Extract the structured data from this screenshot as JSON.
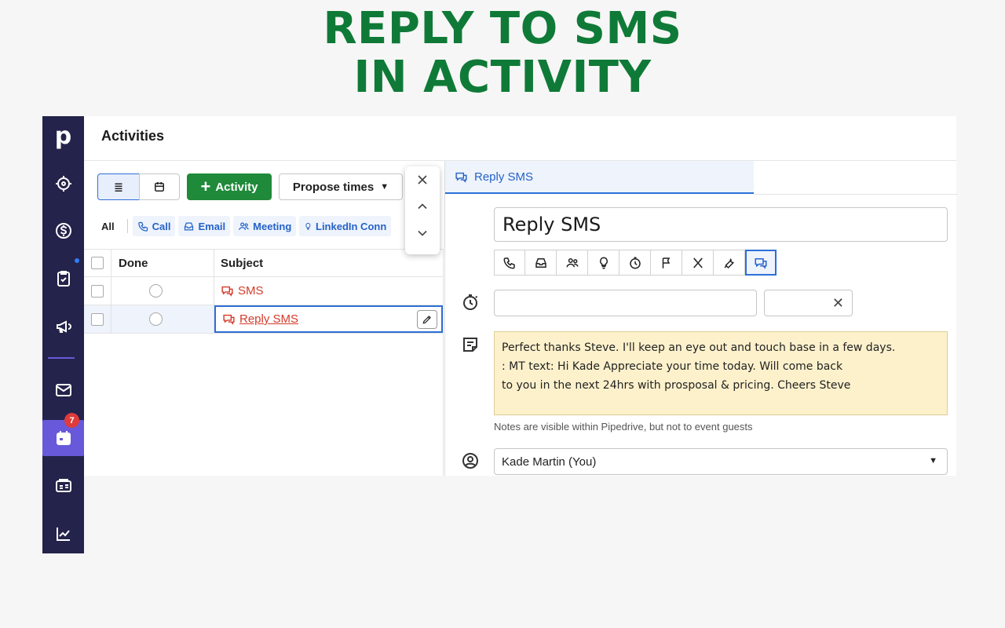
{
  "headline": {
    "line1": "REPLY TO SMS",
    "line2": "IN ACTIVITY"
  },
  "sidebar": {
    "logo": "p",
    "badge_count": "7",
    "items": [
      "target-icon",
      "dollar-icon",
      "checklist-icon",
      "megaphone-icon",
      "mail-icon",
      "calendar-icon",
      "contacts-icon",
      "chart-icon"
    ]
  },
  "main": {
    "title": "Activities",
    "toolbar": {
      "activity_label": "Activity",
      "propose_label": "Propose times"
    },
    "filters": {
      "all": "All",
      "call": "Call",
      "email": "Email",
      "meeting": "Meeting",
      "linkedin": "LinkedIn Conn"
    },
    "table": {
      "headers": {
        "done": "Done",
        "subject": "Subject"
      },
      "rows": [
        {
          "subject": "SMS"
        },
        {
          "subject": "Reply SMS"
        }
      ]
    }
  },
  "pane": {
    "tab_label": "Reply SMS",
    "subject_value": "Reply SMS",
    "note_lines": [
      "Perfect thanks Steve. I'll keep an eye out and touch base in a few days.",
      ": MT text: Hi Kade Appreciate your time today. Will come back",
      " to you in the next 24hrs with prosposal & pricing. Cheers Steve"
    ],
    "note_hint": "Notes are visible within Pipedrive, but not to event guests",
    "owner": "Kade Martin (You)"
  },
  "colors": {
    "accent_green": "#0f7a37",
    "sidebar": "#24234b",
    "primary_blue": "#2d6fd6",
    "sms_red": "#d33b2a",
    "note_bg": "#fdf1cc"
  }
}
